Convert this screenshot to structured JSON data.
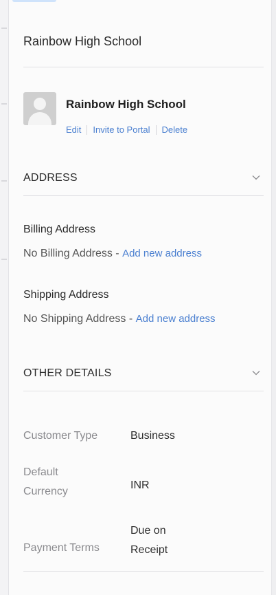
{
  "header": {
    "title": "Rainbow High School"
  },
  "contact": {
    "name": "Rainbow High School",
    "avatar_icon": "default-avatar-icon",
    "actions": [
      "Edit",
      "Invite to Portal",
      "Delete"
    ]
  },
  "address_section": {
    "title": "ADDRESS",
    "chevron_icon": "chevron-down-icon",
    "billing": {
      "label": "Billing Address",
      "empty_text": "No Billing Address - ",
      "add_link": "Add new address"
    },
    "shipping": {
      "label": "Shipping Address",
      "empty_text": "No Shipping Address - ",
      "add_link": "Add new address"
    }
  },
  "other_details": {
    "title": "OTHER DETAILS",
    "chevron_icon": "chevron-down-icon",
    "rows": [
      {
        "label_lines": [
          "Customer Type"
        ],
        "value_lines": [
          "Business"
        ]
      },
      {
        "label_lines": [
          "Default",
          "Currency"
        ],
        "value_lines": [
          "INR"
        ]
      },
      {
        "label_lines": [
          "Payment Terms"
        ],
        "value_lines": [
          "Due on",
          "Receipt"
        ]
      }
    ]
  },
  "colors": {
    "link": "#4a7fd0",
    "label_muted": "#8a8a8e",
    "divider": "#e1e1e4"
  }
}
